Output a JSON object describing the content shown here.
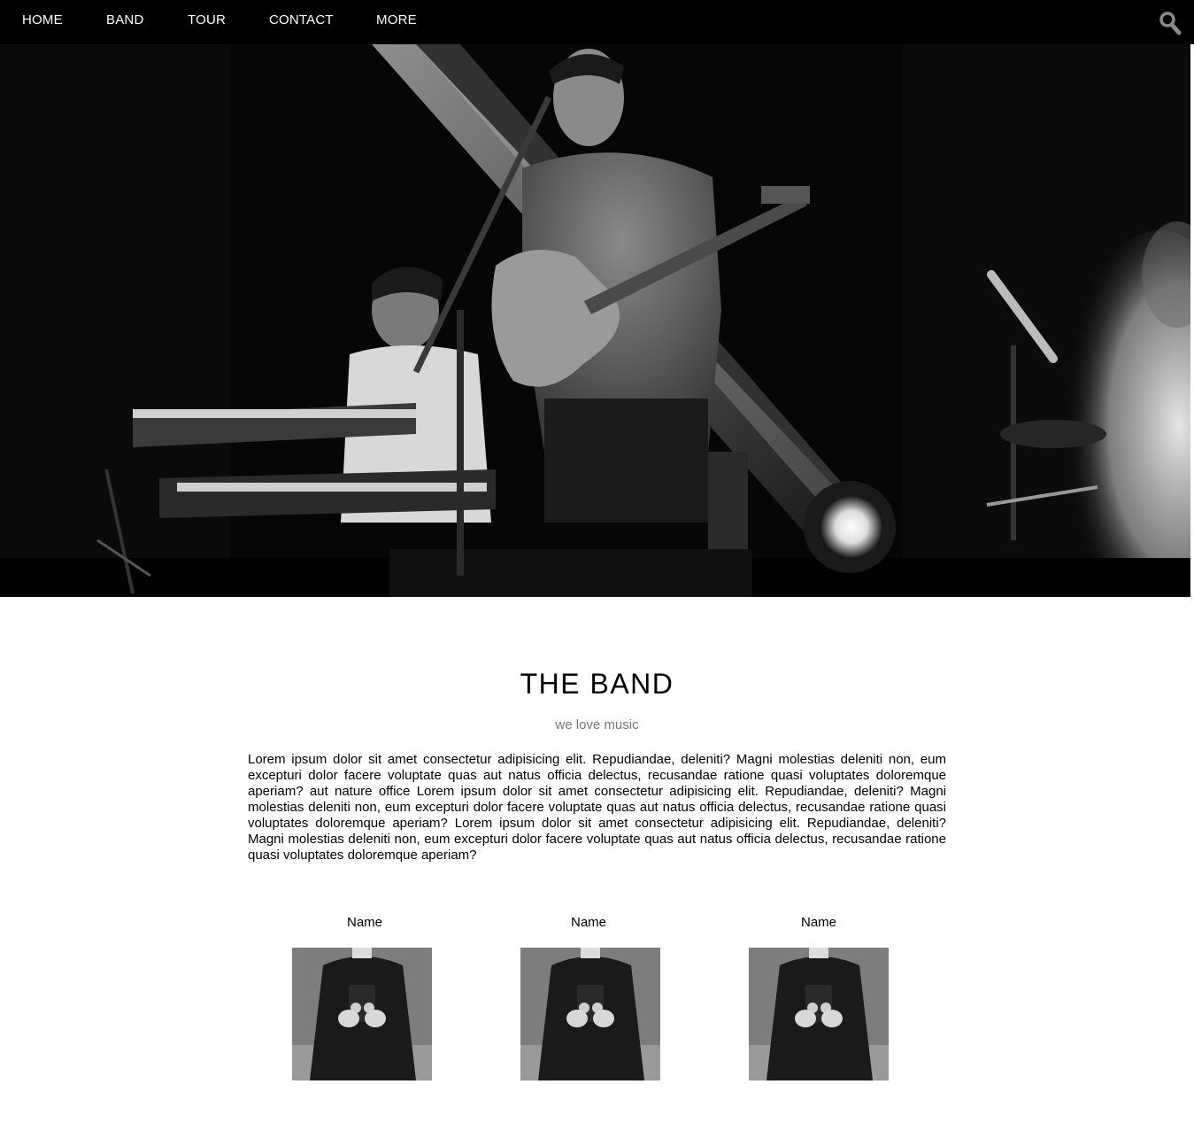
{
  "nav": {
    "items": [
      {
        "label": "HOME"
      },
      {
        "label": "BAND"
      },
      {
        "label": "TOUR"
      },
      {
        "label": "CONTACT"
      },
      {
        "label": "MORE"
      }
    ],
    "search_icon": "search-icon"
  },
  "hero": {
    "image": "black-and-white concert photo: guitarist singing at microphone, keyboard player, stage spotlight"
  },
  "band": {
    "title": "THE BAND",
    "tagline": "we love music",
    "description": "Lorem ipsum dolor sit amet consectetur adipisicing elit. Repudiandae, deleniti? Magni molestias deleniti non, eum excepturi dolor facere voluptate quas aut natus officia delectus, recusandae ratione quasi voluptates doloremque aperiam? aut nature office Lorem ipsum dolor sit amet consectetur adipisicing elit. Repudiandae, deleniti? Magni molestias deleniti non, eum excepturi dolor facere voluptate quas aut natus officia delectus, recusandae ratione quasi voluptates doloremque aperiam? Lorem ipsum dolor sit amet consectetur adipisicing elit. Repudiandae, deleniti? Magni molestias deleniti non, eum excepturi dolor facere voluptate quas aut natus officia delectus, recusandae ratione quasi voluptates doloremque aperiam?",
    "members": [
      {
        "name": "Name"
      },
      {
        "name": "Name"
      },
      {
        "name": "Name"
      }
    ]
  }
}
